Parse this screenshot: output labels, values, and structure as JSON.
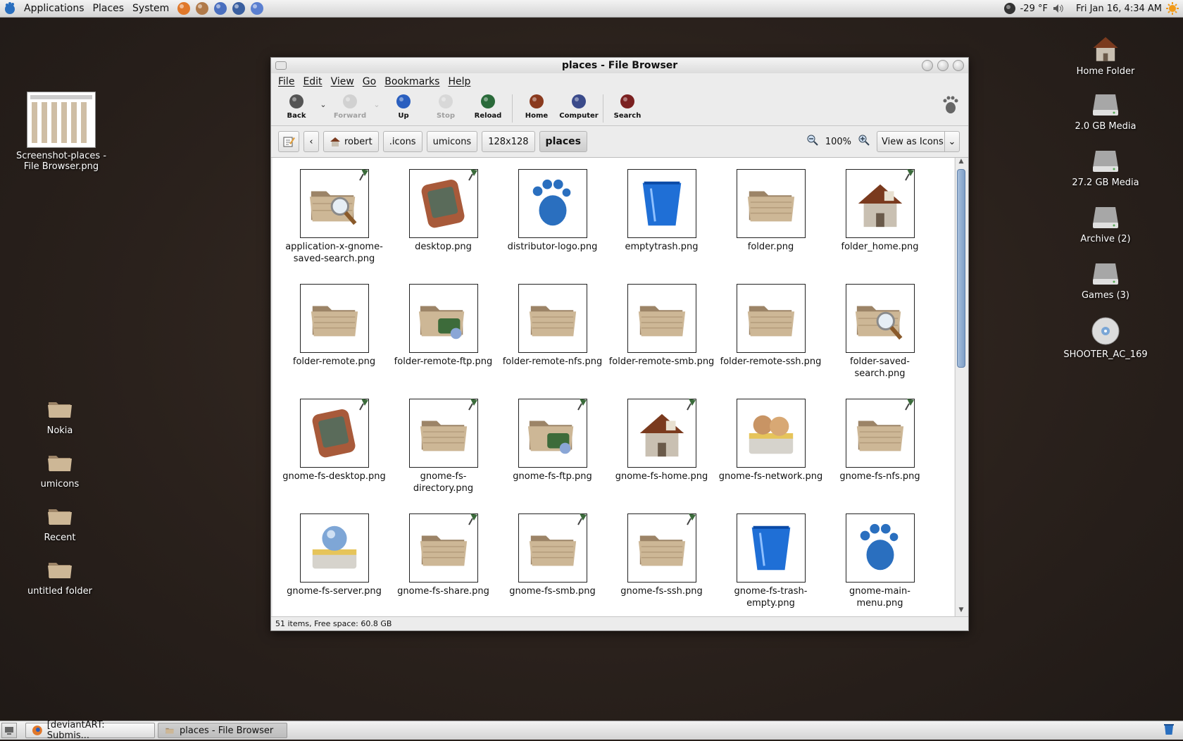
{
  "top_panel": {
    "menus": [
      "Applications",
      "Places",
      "System"
    ],
    "launchers": [
      "firefox-icon",
      "user-icon",
      "doc-icon",
      "app-icon",
      "app2-icon"
    ],
    "weather": "-29 °F",
    "clock": "Fri Jan 16,  4:34 AM"
  },
  "desktop_left": [
    {
      "label": "Screenshot-places -\nFile Browser.png",
      "icon": "screenshot-thumbnail"
    },
    {
      "label": "Nokia",
      "icon": "folder-icon"
    },
    {
      "label": "umicons",
      "icon": "folder-icon"
    },
    {
      "label": "Recent",
      "icon": "folder-icon"
    },
    {
      "label": "untitled folder",
      "icon": "folder-icon"
    }
  ],
  "desktop_right": [
    {
      "label": "Home Folder",
      "icon": "home-icon"
    },
    {
      "label": "2.0 GB Media",
      "icon": "drive-icon"
    },
    {
      "label": "27.2 GB Media",
      "icon": "drive-icon"
    },
    {
      "label": "Archive (2)",
      "icon": "drive-icon"
    },
    {
      "label": "Games (3)",
      "icon": "drive-icon"
    },
    {
      "label": "SHOOTER_AC_169",
      "icon": "disc-icon"
    }
  ],
  "window": {
    "title": "places - File Browser",
    "menu": [
      "File",
      "Edit",
      "View",
      "Go",
      "Bookmarks",
      "Help"
    ],
    "toolbar": [
      {
        "label": "Back",
        "icon": "back-icon",
        "enabled": true,
        "dropdown": true
      },
      {
        "label": "Forward",
        "icon": "forward-icon",
        "enabled": false,
        "dropdown": true
      },
      {
        "label": "Up",
        "icon": "up-icon",
        "enabled": true
      },
      {
        "label": "Stop",
        "icon": "stop-icon",
        "enabled": false
      },
      {
        "label": "Reload",
        "icon": "reload-icon",
        "enabled": true
      },
      {
        "label": "Home",
        "icon": "home-icon",
        "enabled": true
      },
      {
        "label": "Computer",
        "icon": "computer-icon",
        "enabled": true
      },
      {
        "label": "Search",
        "icon": "search-icon",
        "enabled": true
      }
    ],
    "breadcrumbs": [
      "robert",
      ".icons",
      "umicons",
      "128x128",
      "places"
    ],
    "zoom": "100%",
    "view_mode": "View as Icons",
    "status": "51 items, Free space: 60.8 GB",
    "files": [
      {
        "name": "application-x-gnome-saved-search.png",
        "kind": "folder-search",
        "emblem": true
      },
      {
        "name": "desktop.png",
        "kind": "monitor",
        "emblem": true
      },
      {
        "name": "distributor-logo.png",
        "kind": "foot",
        "emblem": false
      },
      {
        "name": "emptytrash.png",
        "kind": "trash",
        "emblem": false
      },
      {
        "name": "folder.png",
        "kind": "folder",
        "emblem": false
      },
      {
        "name": "folder_home.png",
        "kind": "house",
        "emblem": true
      },
      {
        "name": "folder-remote.png",
        "kind": "folder",
        "emblem": false
      },
      {
        "name": "folder-remote-ftp.png",
        "kind": "folder-net",
        "emblem": false
      },
      {
        "name": "folder-remote-nfs.png",
        "kind": "folder",
        "emblem": false
      },
      {
        "name": "folder-remote-smb.png",
        "kind": "folder",
        "emblem": false
      },
      {
        "name": "folder-remote-ssh.png",
        "kind": "folder",
        "emblem": false
      },
      {
        "name": "folder-saved-search.png",
        "kind": "folder-search",
        "emblem": false
      },
      {
        "name": "gnome-fs-desktop.png",
        "kind": "monitor",
        "emblem": true
      },
      {
        "name": "gnome-fs-directory.png",
        "kind": "folder",
        "emblem": true
      },
      {
        "name": "gnome-fs-ftp.png",
        "kind": "folder-net",
        "emblem": true
      },
      {
        "name": "gnome-fs-home.png",
        "kind": "house",
        "emblem": true
      },
      {
        "name": "gnome-fs-network.png",
        "kind": "network",
        "emblem": false
      },
      {
        "name": "gnome-fs-nfs.png",
        "kind": "folder",
        "emblem": true
      },
      {
        "name": "gnome-fs-server.png",
        "kind": "server",
        "emblem": false
      },
      {
        "name": "gnome-fs-share.png",
        "kind": "folder",
        "emblem": true
      },
      {
        "name": "gnome-fs-smb.png",
        "kind": "folder",
        "emblem": true
      },
      {
        "name": "gnome-fs-ssh.png",
        "kind": "folder",
        "emblem": true
      },
      {
        "name": "gnome-fs-trash-empty.png",
        "kind": "trash",
        "emblem": false
      },
      {
        "name": "gnome-main-menu.png",
        "kind": "foot",
        "emblem": false
      }
    ]
  },
  "taskbar": [
    {
      "label": "[deviantART: Submis...",
      "icon": "firefox-icon",
      "active": false
    },
    {
      "label": "places - File Browser",
      "icon": "folder-icon",
      "active": true
    }
  ],
  "colors": {
    "desktop": "#2a211c",
    "folder": "#bfa98a",
    "accent": "#2a6fbf"
  }
}
